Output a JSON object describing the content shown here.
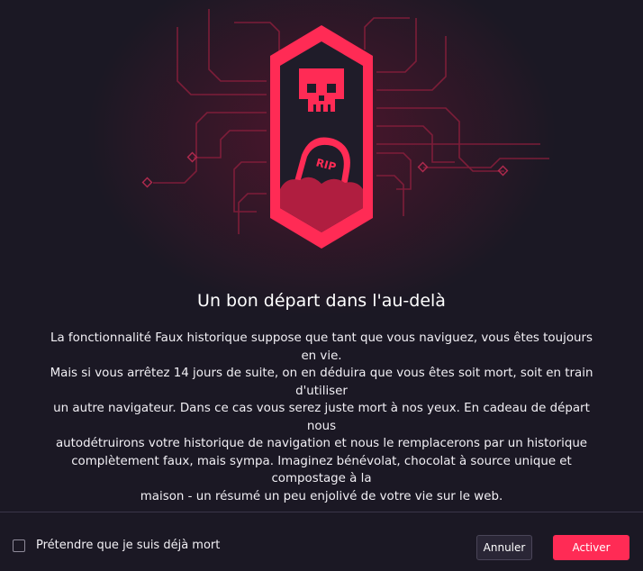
{
  "dialog": {
    "title": "Un bon départ dans l'au-delà",
    "body_lines": [
      "La fonctionnalité Faux historique suppose que tant que vous naviguez, vous êtes toujours en vie.",
      "Mais si vous arrêtez 14 jours de suite, on en déduira que vous êtes soit mort, soit en train d'utiliser",
      "un autre navigateur. Dans ce cas vous serez juste mort à nos yeux. En cadeau de départ nous",
      "autodétruirons votre historique de navigation et nous le remplacerons par un historique",
      "complètement faux, mais sympa. Imaginez bénévolat, chocolat à source unique et compostage à la",
      "maison - un résumé un peu enjolivé de votre vie sur le web."
    ],
    "illustration": {
      "badge_icon": "skull-icon",
      "tombstone_icon": "tombstone-icon",
      "tombstone_text": "RIP"
    }
  },
  "footer": {
    "checkbox_label": "Prétendre que je suis déjà mort",
    "checkbox_checked": false,
    "cancel_label": "Annuler",
    "activate_label": "Activer"
  },
  "colors": {
    "accent": "#ff2b55",
    "background": "#1b1824",
    "badge_fill": "#1f1c29",
    "circuit": "#8a1f3c",
    "mound": "#b01e40"
  }
}
